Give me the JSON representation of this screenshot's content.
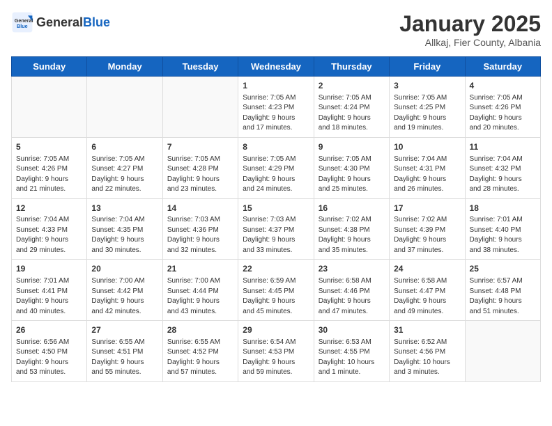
{
  "header": {
    "logo_general": "General",
    "logo_blue": "Blue",
    "month_title": "January 2025",
    "subtitle": "Allkaj, Fier County, Albania"
  },
  "weekdays": [
    "Sunday",
    "Monday",
    "Tuesday",
    "Wednesday",
    "Thursday",
    "Friday",
    "Saturday"
  ],
  "weeks": [
    [
      {
        "day": "",
        "info": ""
      },
      {
        "day": "",
        "info": ""
      },
      {
        "day": "",
        "info": ""
      },
      {
        "day": "1",
        "info": "Sunrise: 7:05 AM\nSunset: 4:23 PM\nDaylight: 9 hours\nand 17 minutes."
      },
      {
        "day": "2",
        "info": "Sunrise: 7:05 AM\nSunset: 4:24 PM\nDaylight: 9 hours\nand 18 minutes."
      },
      {
        "day": "3",
        "info": "Sunrise: 7:05 AM\nSunset: 4:25 PM\nDaylight: 9 hours\nand 19 minutes."
      },
      {
        "day": "4",
        "info": "Sunrise: 7:05 AM\nSunset: 4:26 PM\nDaylight: 9 hours\nand 20 minutes."
      }
    ],
    [
      {
        "day": "5",
        "info": "Sunrise: 7:05 AM\nSunset: 4:26 PM\nDaylight: 9 hours\nand 21 minutes."
      },
      {
        "day": "6",
        "info": "Sunrise: 7:05 AM\nSunset: 4:27 PM\nDaylight: 9 hours\nand 22 minutes."
      },
      {
        "day": "7",
        "info": "Sunrise: 7:05 AM\nSunset: 4:28 PM\nDaylight: 9 hours\nand 23 minutes."
      },
      {
        "day": "8",
        "info": "Sunrise: 7:05 AM\nSunset: 4:29 PM\nDaylight: 9 hours\nand 24 minutes."
      },
      {
        "day": "9",
        "info": "Sunrise: 7:05 AM\nSunset: 4:30 PM\nDaylight: 9 hours\nand 25 minutes."
      },
      {
        "day": "10",
        "info": "Sunrise: 7:04 AM\nSunset: 4:31 PM\nDaylight: 9 hours\nand 26 minutes."
      },
      {
        "day": "11",
        "info": "Sunrise: 7:04 AM\nSunset: 4:32 PM\nDaylight: 9 hours\nand 28 minutes."
      }
    ],
    [
      {
        "day": "12",
        "info": "Sunrise: 7:04 AM\nSunset: 4:33 PM\nDaylight: 9 hours\nand 29 minutes."
      },
      {
        "day": "13",
        "info": "Sunrise: 7:04 AM\nSunset: 4:35 PM\nDaylight: 9 hours\nand 30 minutes."
      },
      {
        "day": "14",
        "info": "Sunrise: 7:03 AM\nSunset: 4:36 PM\nDaylight: 9 hours\nand 32 minutes."
      },
      {
        "day": "15",
        "info": "Sunrise: 7:03 AM\nSunset: 4:37 PM\nDaylight: 9 hours\nand 33 minutes."
      },
      {
        "day": "16",
        "info": "Sunrise: 7:02 AM\nSunset: 4:38 PM\nDaylight: 9 hours\nand 35 minutes."
      },
      {
        "day": "17",
        "info": "Sunrise: 7:02 AM\nSunset: 4:39 PM\nDaylight: 9 hours\nand 37 minutes."
      },
      {
        "day": "18",
        "info": "Sunrise: 7:01 AM\nSunset: 4:40 PM\nDaylight: 9 hours\nand 38 minutes."
      }
    ],
    [
      {
        "day": "19",
        "info": "Sunrise: 7:01 AM\nSunset: 4:41 PM\nDaylight: 9 hours\nand 40 minutes."
      },
      {
        "day": "20",
        "info": "Sunrise: 7:00 AM\nSunset: 4:42 PM\nDaylight: 9 hours\nand 42 minutes."
      },
      {
        "day": "21",
        "info": "Sunrise: 7:00 AM\nSunset: 4:44 PM\nDaylight: 9 hours\nand 43 minutes."
      },
      {
        "day": "22",
        "info": "Sunrise: 6:59 AM\nSunset: 4:45 PM\nDaylight: 9 hours\nand 45 minutes."
      },
      {
        "day": "23",
        "info": "Sunrise: 6:58 AM\nSunset: 4:46 PM\nDaylight: 9 hours\nand 47 minutes."
      },
      {
        "day": "24",
        "info": "Sunrise: 6:58 AM\nSunset: 4:47 PM\nDaylight: 9 hours\nand 49 minutes."
      },
      {
        "day": "25",
        "info": "Sunrise: 6:57 AM\nSunset: 4:48 PM\nDaylight: 9 hours\nand 51 minutes."
      }
    ],
    [
      {
        "day": "26",
        "info": "Sunrise: 6:56 AM\nSunset: 4:50 PM\nDaylight: 9 hours\nand 53 minutes."
      },
      {
        "day": "27",
        "info": "Sunrise: 6:55 AM\nSunset: 4:51 PM\nDaylight: 9 hours\nand 55 minutes."
      },
      {
        "day": "28",
        "info": "Sunrise: 6:55 AM\nSunset: 4:52 PM\nDaylight: 9 hours\nand 57 minutes."
      },
      {
        "day": "29",
        "info": "Sunrise: 6:54 AM\nSunset: 4:53 PM\nDaylight: 9 hours\nand 59 minutes."
      },
      {
        "day": "30",
        "info": "Sunrise: 6:53 AM\nSunset: 4:55 PM\nDaylight: 10 hours\nand 1 minute."
      },
      {
        "day": "31",
        "info": "Sunrise: 6:52 AM\nSunset: 4:56 PM\nDaylight: 10 hours\nand 3 minutes."
      },
      {
        "day": "",
        "info": ""
      }
    ]
  ]
}
